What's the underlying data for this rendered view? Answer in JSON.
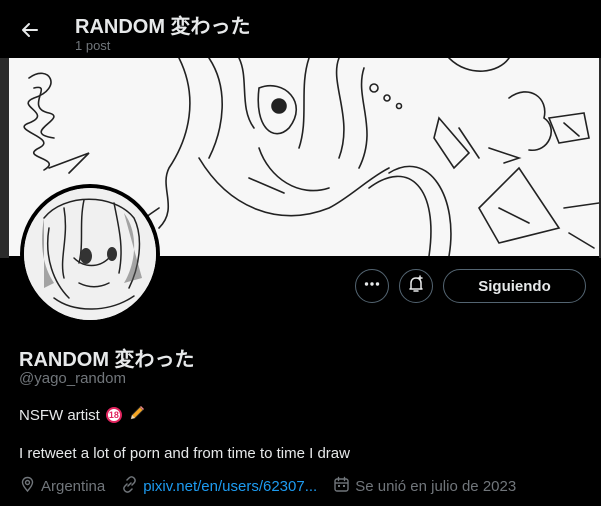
{
  "header": {
    "title": "RANDOM 変わった",
    "post_count": "1 post"
  },
  "actions": {
    "follow_label": "Siguiendo"
  },
  "profile": {
    "display_name": "RANDOM 変わった",
    "handle": "@yago_random",
    "bio_line1": "NSFW artist",
    "badge_text": "18",
    "bio_line2": "I retweet a lot of porn and from time to time I draw",
    "location": "Argentina",
    "website": "pixiv.net/en/users/62307...",
    "joined": "Se unió en julio de 2023"
  },
  "icons": {
    "back": "arrow-left-icon",
    "more": "more-dots-icon",
    "bell": "bell-plus-icon",
    "location": "map-pin-icon",
    "link": "link-icon",
    "calendar": "calendar-icon"
  },
  "colors": {
    "background": "#000000",
    "text": "#e7e9ea",
    "muted": "#71767b",
    "link": "#1d9bf0",
    "border": "#536471"
  }
}
